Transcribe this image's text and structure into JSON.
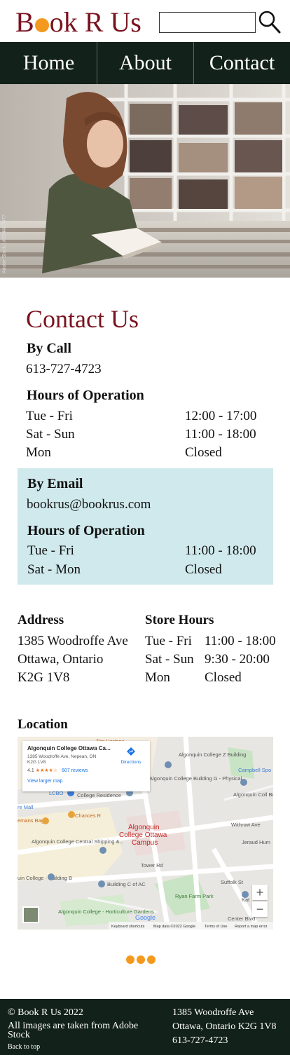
{
  "brand": {
    "name_pre": "B",
    "name_post": "ok R Us",
    "accent": "#f39a1e",
    "primary": "#7a1420",
    "dark": "#13211b"
  },
  "search": {
    "placeholder": "",
    "icon": "search-icon"
  },
  "nav": {
    "items": [
      "Home",
      "About",
      "Contact"
    ]
  },
  "hero": {
    "credit": "Adobe Stock | #294427077"
  },
  "contact": {
    "title": "Contact Us",
    "by_call": {
      "heading": "By Call",
      "phone": "613-727-4723",
      "hours_heading": "Hours of Operation",
      "hours": [
        {
          "day": "Tue - Fri",
          "time": "12:00 - 17:00"
        },
        {
          "day": "Sat - Sun",
          "time": "11:00 - 18:00"
        },
        {
          "day": "Mon",
          "time": "Closed"
        }
      ]
    },
    "by_email": {
      "heading": "By Email",
      "email": "bookrus@bookrus.com",
      "hours_heading": "Hours of Operation",
      "hours": [
        {
          "day": "Tue - Fri",
          "time": "11:00 - 18:00"
        },
        {
          "day": "Sat - Mon",
          "time": "Closed"
        }
      ],
      "bg": "#cfe9ec"
    }
  },
  "address": {
    "heading": "Address",
    "lines": [
      "1385 Woodroffe Ave",
      "Ottawa, Ontario",
      "K2G 1V8"
    ]
  },
  "store_hours": {
    "heading": "Store Hours",
    "rows": [
      {
        "day": "Tue - Fri",
        "time": "11:00 - 18:00"
      },
      {
        "day": "Sat - Sun",
        "time": "9:30 - 20:00"
      },
      {
        "day": "Mon",
        "time": "Closed"
      }
    ]
  },
  "location": {
    "heading": "Location",
    "map": {
      "card_title": "Algonquin College Ottawa Ca...",
      "card_address_1": "1385 Woodroffe Ave, Nepean, ON",
      "card_address_2": "K2G 1V8",
      "rating": "4.1",
      "stars": "★★★★☆",
      "reviews": "607 reviews",
      "larger_map": "View larger map",
      "directions": "Directions",
      "labels": {
        "tim": "Tim Hortons",
        "z_building": "Algonquin College Z Building",
        "campbell": "Campbell Spo",
        "bldg_g": "Algonquin College Building G - Physical...",
        "lcbo": "LCBO",
        "residence": "College Residence",
        "bldg_v": "Algonquin Coll Building V - An",
        "mall": "re Mall",
        "chances": "Chances R",
        "bagel": "emans Bagel",
        "campus_1": "Algonquin",
        "campus_2": "College Ottawa",
        "campus_3": "Campus",
        "withrow": "Withrow Ave",
        "jeraud": "Jeraud Hum",
        "shipping": "Algonquin College Central Shipping &...",
        "tower": "Tower Rd",
        "bldg_b": "uin College - Building B",
        "bldg_c": "Building C of AC",
        "suffolk": "Suffolk St",
        "ryan": "Ryan Farm Park",
        "kat": "Kat",
        "hort": "Algonquin College - Horticulture Gardens",
        "center": "Center Blvd",
        "google": "Google",
        "footer_1": "Keyboard shortcuts",
        "footer_2": "Map data ©2022 Google",
        "footer_3": "Terms of Use",
        "footer_4": "Report a map error"
      },
      "zoom_in": "+",
      "zoom_out": "−"
    }
  },
  "footer": {
    "copyright": "© Book R Us 2022",
    "images_note": "All images are taken from Adobe Stock",
    "back_to_top": "Back to top",
    "address_1": "1385 Woodroffe Ave",
    "address_2": "Ottawa, Ontario K2G 1V8",
    "phone": "613-727-4723"
  }
}
